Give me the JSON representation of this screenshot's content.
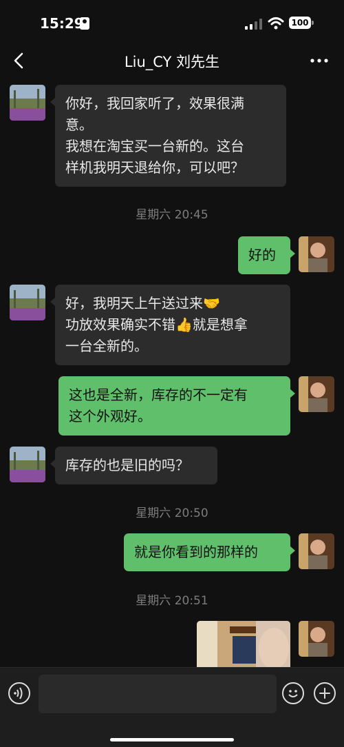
{
  "status_bar": {
    "time": "15:29",
    "battery": "100"
  },
  "nav": {
    "title": "Liu_CY 刘先生"
  },
  "messages": [
    {
      "from": "contact",
      "lines": [
        "你好，我回家听了，效果很满",
        "意。",
        "我想在淘宝买一台新的。这台",
        "样机我明天退给你，可以吧？"
      ]
    },
    {
      "timestamp": "星期六 20:45"
    },
    {
      "from": "me",
      "lines": [
        "好的"
      ]
    },
    {
      "from": "contact",
      "lines": [
        "好，我明天上午送过来🤝",
        "功放效果确实不错👍就是想拿",
        "一台全新的。"
      ]
    },
    {
      "from": "me",
      "lines": [
        "这也是全新，库存的不一定有",
        "这个外观好。"
      ]
    },
    {
      "from": "contact",
      "lines": [
        "库存的也是旧的吗？"
      ]
    },
    {
      "timestamp": "星期六 20:50"
    },
    {
      "from": "me",
      "lines": [
        "就是你看到的那样的"
      ]
    },
    {
      "timestamp": "星期六 20:51"
    },
    {
      "from": "me",
      "type": "image"
    }
  ],
  "input_bar": {
    "placeholder": ""
  },
  "icons": {
    "back": "chevron-left-icon",
    "more": "more-dots-icon",
    "voice": "voice-icon",
    "emoji": "emoji-icon",
    "plus": "plus-icon"
  },
  "colors": {
    "outgoing_bubble": "#5fbf6a",
    "incoming_bubble": "#2c2c2c",
    "background": "#111111"
  }
}
